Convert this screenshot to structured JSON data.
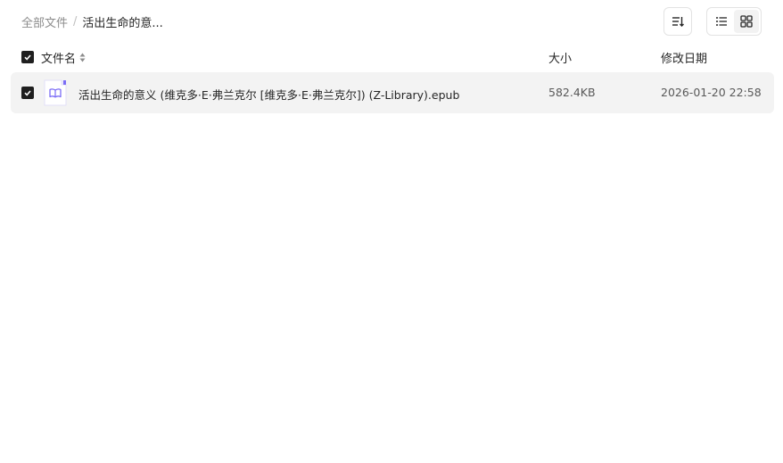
{
  "breadcrumb": {
    "root": "全部文件",
    "separator": "/",
    "current": "活出生命的意..."
  },
  "toolbar": {
    "sort_icon": "sort-icon",
    "list_view_icon": "list-view-icon",
    "grid_view_icon": "grid-view-icon"
  },
  "table": {
    "columns": {
      "name": "文件名",
      "size": "大小",
      "modified": "修改日期"
    },
    "rows": [
      {
        "name": "活出生命的意义 (维克多·E·弗兰克尔 [维克多·E·弗兰克尔]) (Z-Library).epub",
        "size": "582.4KB",
        "modified": "2026-01-20 22:58",
        "icon": "epub-book-icon",
        "selected": true
      }
    ]
  },
  "colors": {
    "accent": "#7b6cf6",
    "checkbox": "#1f1f1f",
    "row_selected_bg": "#f3f3f3"
  }
}
